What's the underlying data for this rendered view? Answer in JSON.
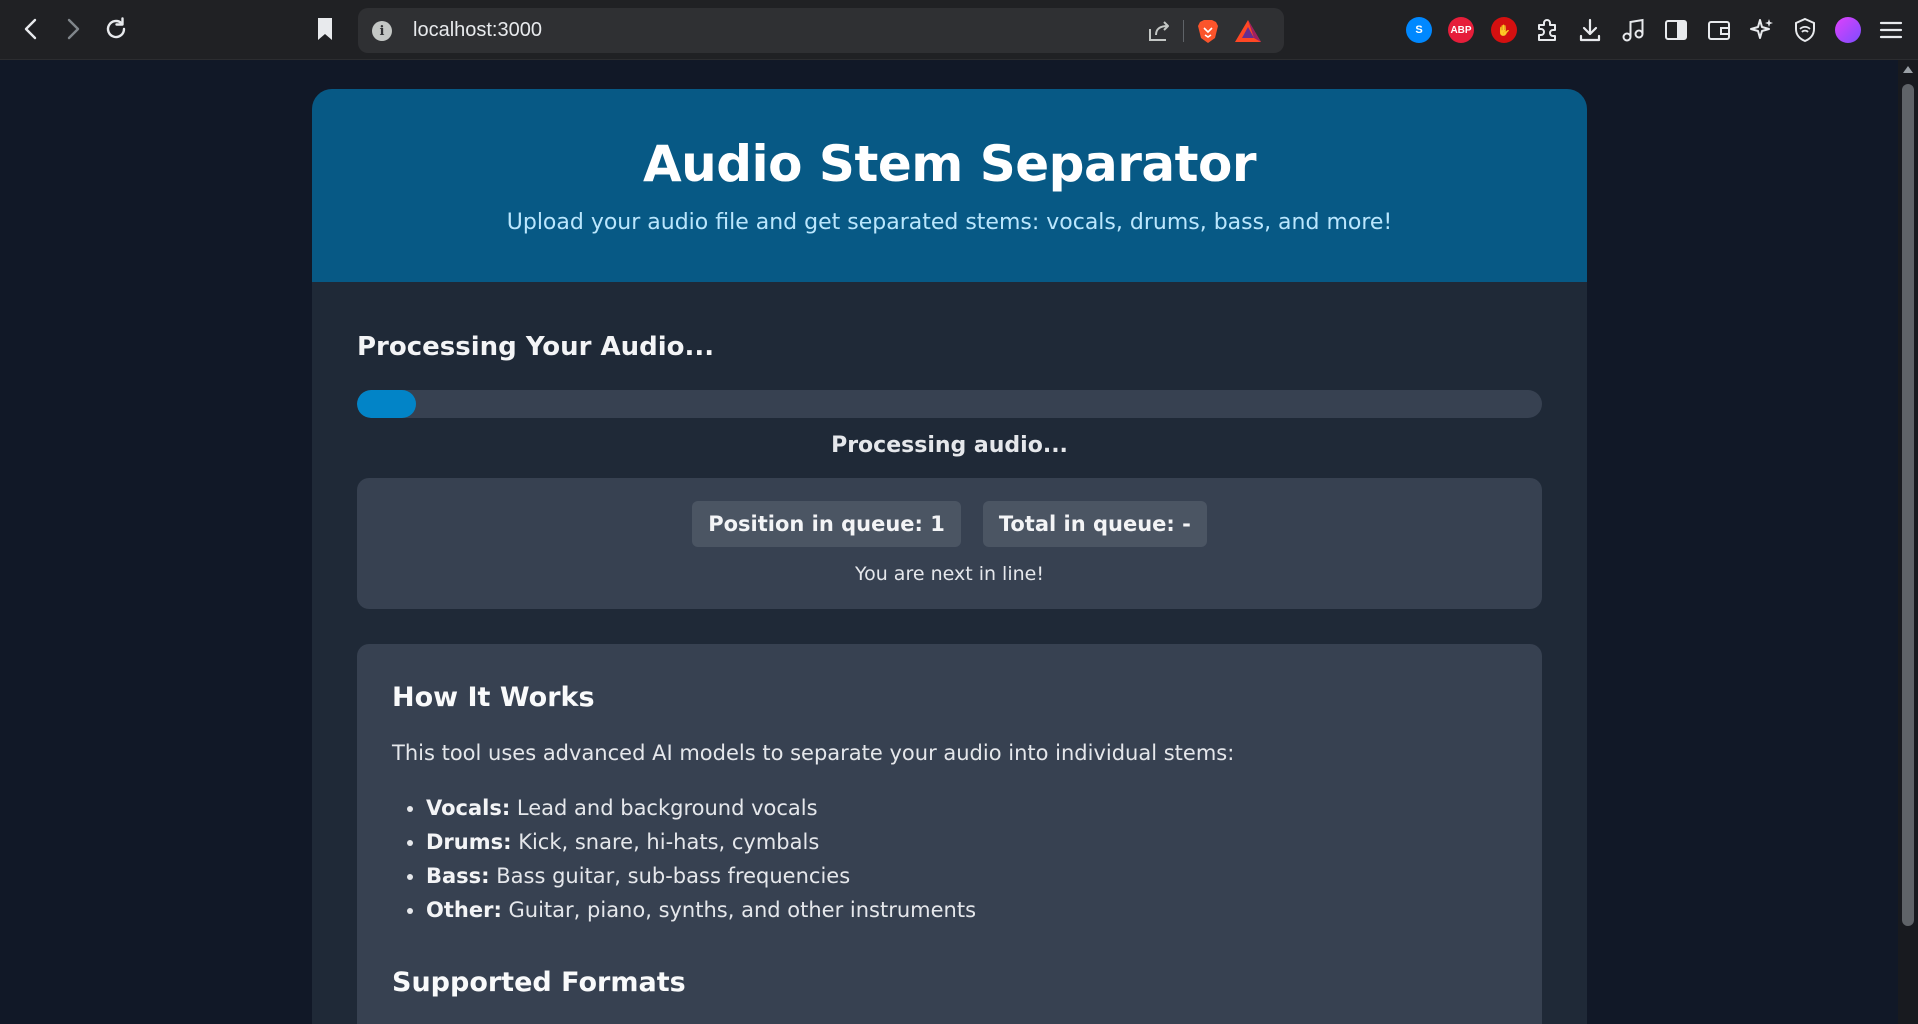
{
  "browser": {
    "url": "localhost:3000",
    "extensions": [
      "shazam-icon",
      "adblock-plus-icon",
      "hand-stop-icon",
      "puzzle-icon",
      "download-icon",
      "music-icon",
      "sidebar-icon",
      "wallet-icon",
      "leo-ai-icon",
      "vpn-shield-icon",
      "profile-avatar-icon",
      "menu-icon"
    ],
    "adblock_label": "ABP"
  },
  "header": {
    "title": "Audio Stem Separator",
    "subtitle": "Upload your audio file and get separated stems: vocals, drums, bass, and more!"
  },
  "processing": {
    "title": "Processing Your Audio...",
    "progress_fraction": 0.05,
    "status": "Processing audio..."
  },
  "queue": {
    "position_label": "Position in queue: 1",
    "total_label": "Total in queue: -",
    "note": "You are next in line!"
  },
  "how_it_works": {
    "title": "How It Works",
    "intro": "This tool uses advanced AI models to separate your audio into individual stems:",
    "items": [
      {
        "name": "Vocals:",
        "desc": " Lead and background vocals"
      },
      {
        "name": "Drums:",
        "desc": " Kick, snare, hi-hats, cymbals"
      },
      {
        "name": "Bass:",
        "desc": " Bass guitar, sub-bass frequencies"
      },
      {
        "name": "Other:",
        "desc": " Guitar, piano, synths, and other instruments"
      }
    ],
    "formats_title": "Supported Formats"
  },
  "colors": {
    "header_bg": "#075985",
    "progress_fill": "#0284c7",
    "card_bg": "#374151",
    "page_bg": "#111827"
  }
}
